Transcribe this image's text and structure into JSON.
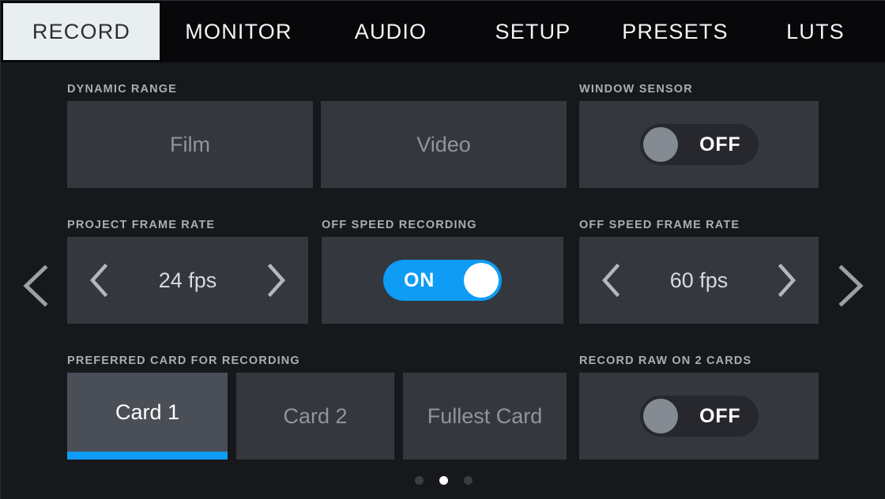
{
  "tabs": [
    {
      "label": "RECORD",
      "active": true,
      "name": "tab-record"
    },
    {
      "label": "MONITOR",
      "active": false,
      "name": "tab-monitor"
    },
    {
      "label": "AUDIO",
      "active": false,
      "name": "tab-audio"
    },
    {
      "label": "SETUP",
      "active": false,
      "name": "tab-setup"
    },
    {
      "label": "PRESETS",
      "active": false,
      "name": "tab-presets"
    },
    {
      "label": "LUTS",
      "active": false,
      "name": "tab-luts"
    }
  ],
  "controls": {
    "dynamic_range": {
      "label": "DYNAMIC RANGE",
      "options": [
        "Film",
        "Video"
      ],
      "selected": null
    },
    "window_sensor": {
      "label": "WINDOW SENSOR",
      "state": "OFF"
    },
    "project_frame_rate": {
      "label": "PROJECT FRAME RATE",
      "value": "24 fps"
    },
    "off_speed_recording": {
      "label": "OFF SPEED RECORDING",
      "state": "ON"
    },
    "off_speed_frame_rate": {
      "label": "OFF SPEED FRAME RATE",
      "value": "60 fps"
    },
    "preferred_card": {
      "label": "PREFERRED CARD FOR RECORDING",
      "options": [
        "Card 1",
        "Card 2",
        "Fullest Card"
      ],
      "selected": "Card 1"
    },
    "record_raw_two_cards": {
      "label": "RECORD RAW ON 2 CARDS",
      "state": "OFF"
    }
  },
  "pagination": {
    "total": 3,
    "current": 2
  },
  "colors": {
    "accent_blue": "#0e9cf5",
    "tab_active_bg": "#e9eef1",
    "panel_bg": "#16181c",
    "tile_bg": "#34373e",
    "tile_selected_bg": "#4a4e57",
    "label_gray": "#a8aeb5",
    "muted_text": "#90949b"
  }
}
